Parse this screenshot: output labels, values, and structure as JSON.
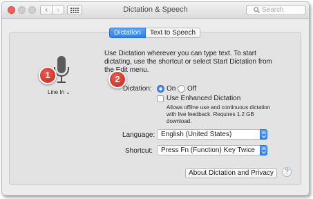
{
  "window": {
    "title": "Dictation & Speech",
    "nav": {
      "back_icon": "‹",
      "forward_icon": "›"
    },
    "search": {
      "placeholder": "Search"
    }
  },
  "tabs": [
    {
      "label": "Dictation",
      "active": true
    },
    {
      "label": "Text to Speech",
      "active": false
    }
  ],
  "mic": {
    "input_label": "Line In ⌄"
  },
  "annotations": {
    "badge1": "1",
    "badge2": "2"
  },
  "dictation": {
    "description": "Use Dictation wherever you can type text. To start dictating, use the shortcut or select Start Dictation from the Edit menu.",
    "label": "Dictation:",
    "on_label": "On",
    "off_label": "Off",
    "selected": "On",
    "enhanced_label": "Use Enhanced Dictation",
    "enhanced_checked": false,
    "enhanced_note_1": "Allows offline use and continuous dictation",
    "enhanced_note_2": "with live feedback. Requires 1.2 GB",
    "enhanced_note_3": "download."
  },
  "language": {
    "label": "Language:",
    "value": "English (United States)"
  },
  "shortcut": {
    "label": "Shortcut:",
    "value": "Press Fn (Function) Key Twice"
  },
  "about_button": "About Dictation and Privacy",
  "help_button": "?",
  "colors": {
    "accent": "#2f7fec",
    "badge": "#d9352a"
  }
}
